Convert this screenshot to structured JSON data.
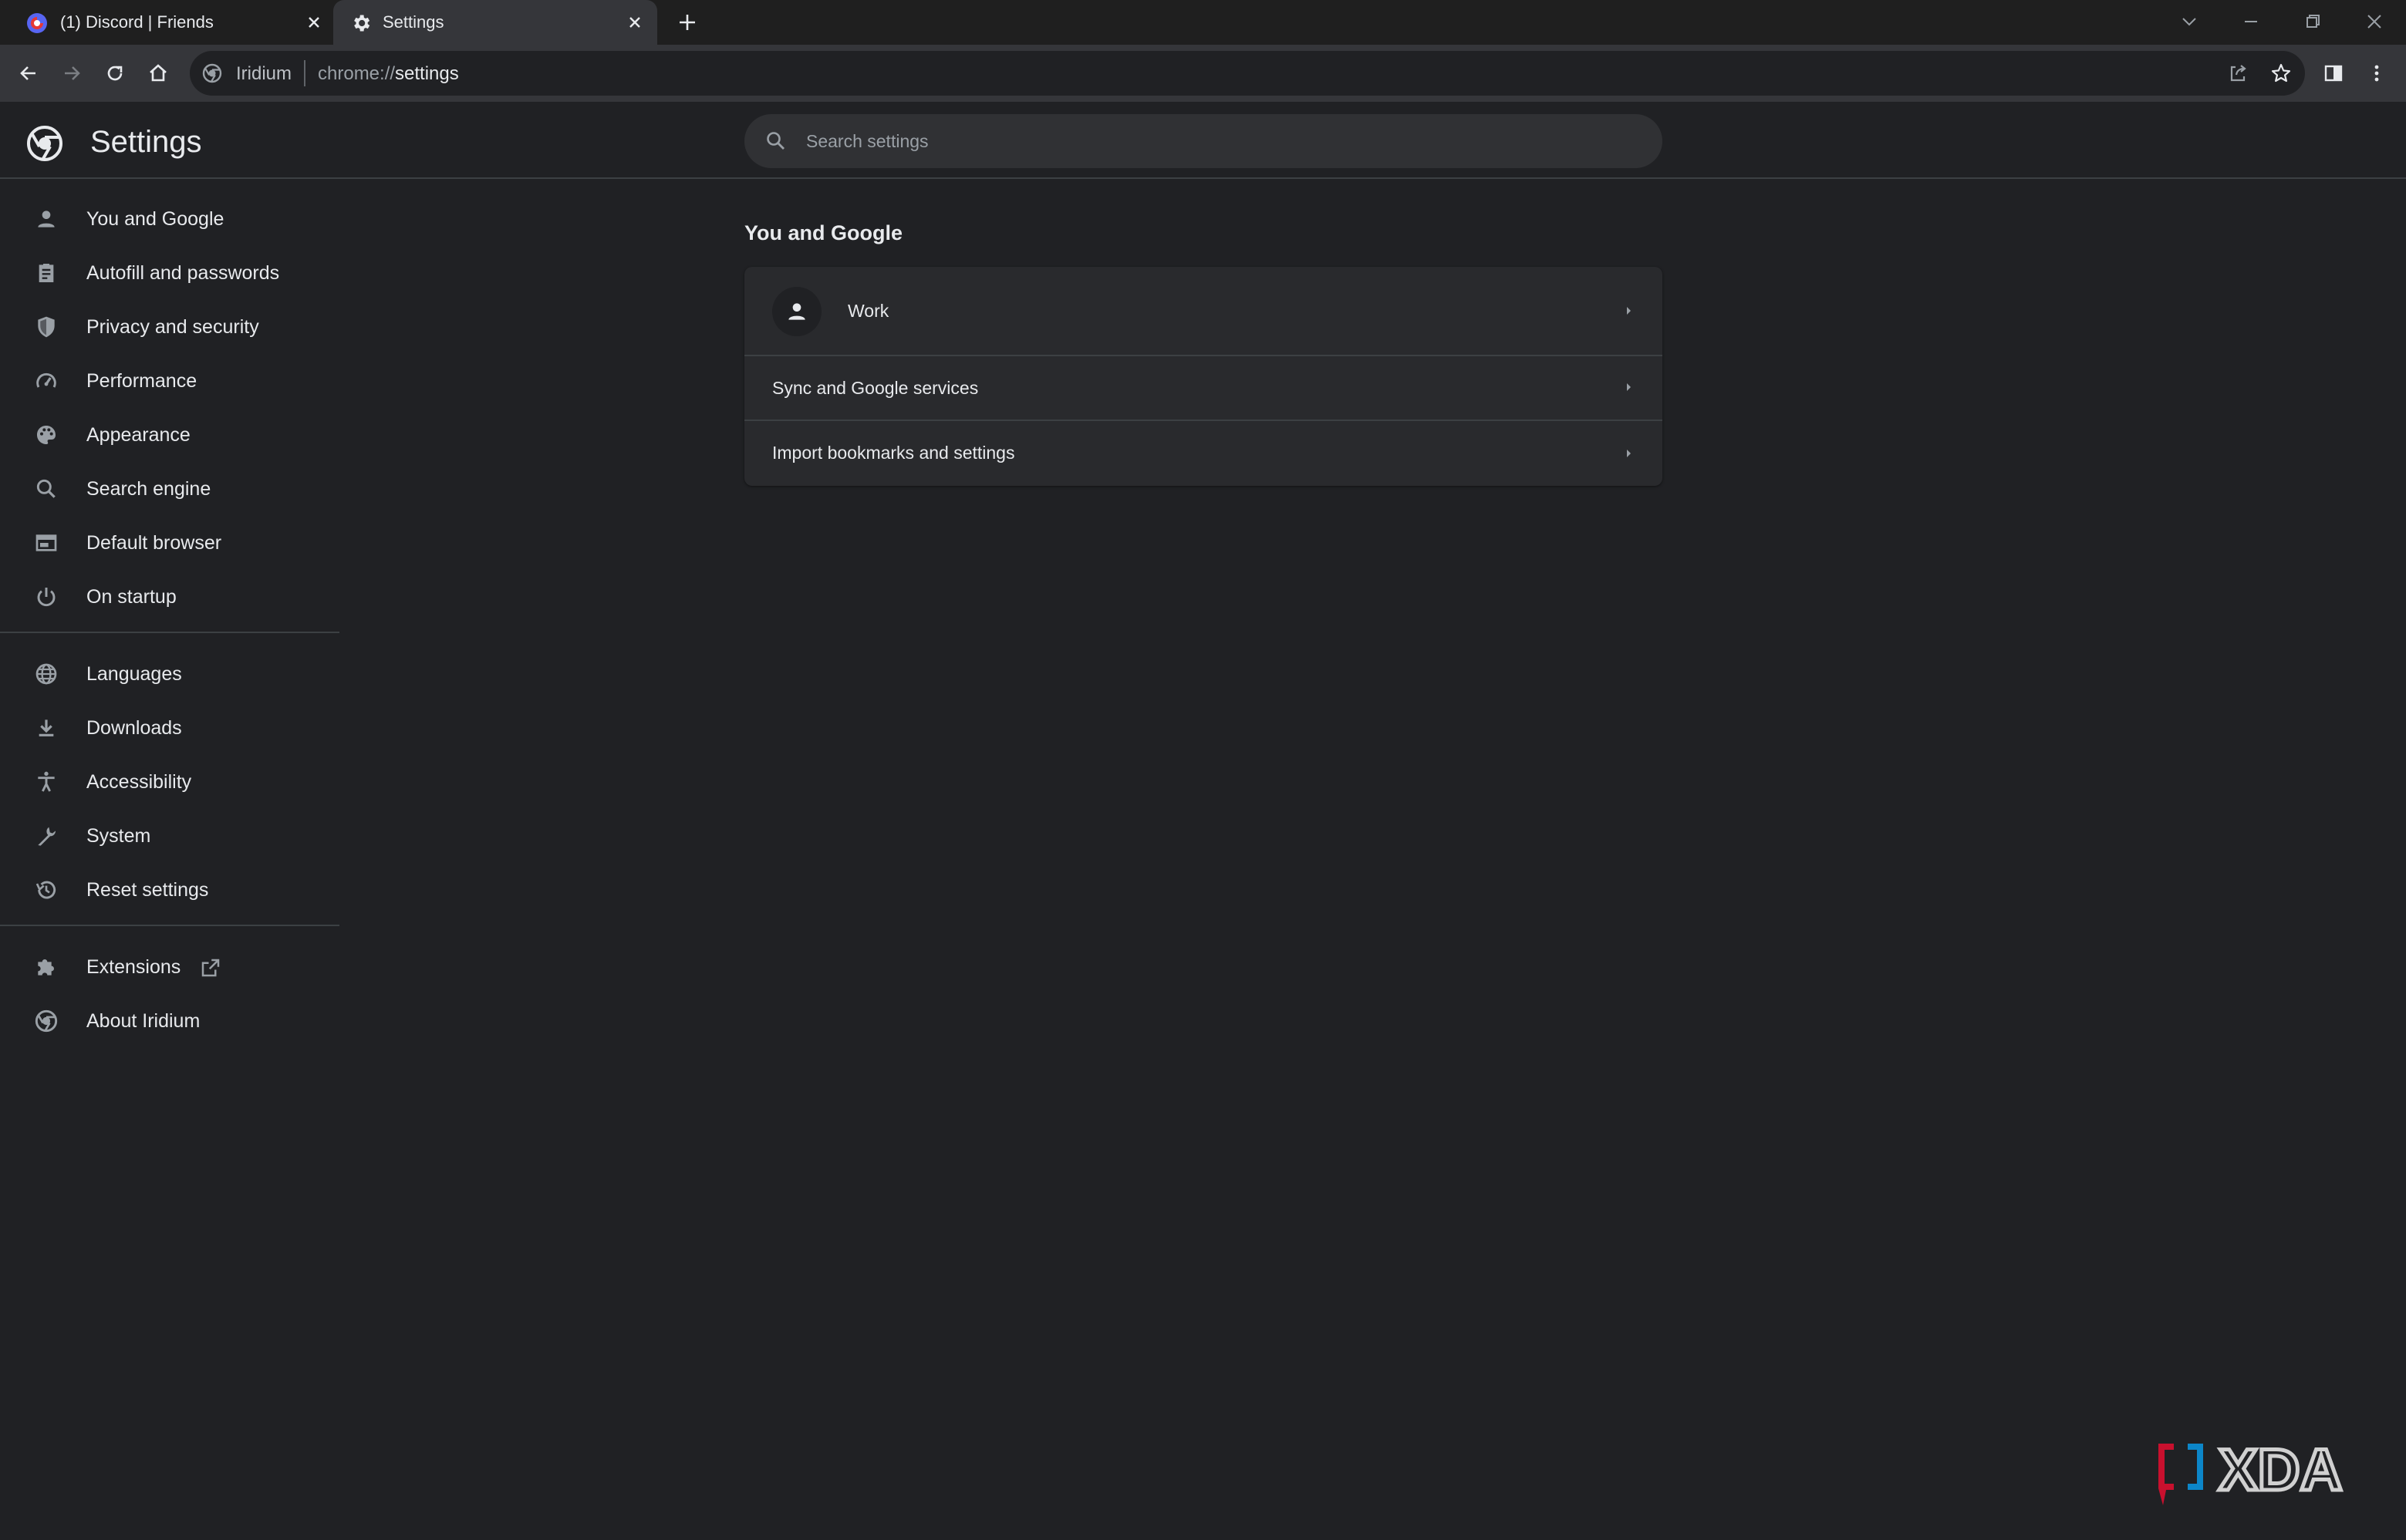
{
  "browser": {
    "tabs": [
      {
        "title": "(1) Discord | Friends",
        "favicon": "discord-icon",
        "active": false
      },
      {
        "title": "Settings",
        "favicon": "gear-icon",
        "active": true
      }
    ],
    "omnibox": {
      "site_name": "Iridium",
      "url_scheme": "chrome://",
      "url_path": "settings"
    }
  },
  "settings": {
    "title": "Settings",
    "search": {
      "placeholder": "Search settings"
    },
    "nav": {
      "group1": [
        {
          "label": "You and Google",
          "icon": "person-icon"
        },
        {
          "label": "Autofill and passwords",
          "icon": "clipboard-icon"
        },
        {
          "label": "Privacy and security",
          "icon": "shield-icon"
        },
        {
          "label": "Performance",
          "icon": "speedometer-icon"
        },
        {
          "label": "Appearance",
          "icon": "palette-icon"
        },
        {
          "label": "Search engine",
          "icon": "search-icon"
        },
        {
          "label": "Default browser",
          "icon": "browser-window-icon"
        },
        {
          "label": "On startup",
          "icon": "power-icon"
        }
      ],
      "group2": [
        {
          "label": "Languages",
          "icon": "globe-icon"
        },
        {
          "label": "Downloads",
          "icon": "download-icon"
        },
        {
          "label": "Accessibility",
          "icon": "accessibility-icon"
        },
        {
          "label": "System",
          "icon": "wrench-icon"
        },
        {
          "label": "Reset settings",
          "icon": "history-icon"
        }
      ],
      "group3": [
        {
          "label": "Extensions",
          "icon": "puzzle-icon"
        },
        {
          "label": "About Iridium",
          "icon": "chromium-logo-icon"
        }
      ]
    },
    "main": {
      "section_title": "You and Google",
      "rows": [
        {
          "label": "Work"
        },
        {
          "label": "Sync and Google services"
        },
        {
          "label": "Import bookmarks and settings"
        }
      ]
    }
  },
  "watermark": {
    "text": "XDA"
  },
  "colors": {
    "background": "#202124",
    "toolbar": "#35363a",
    "card": "#292a2d",
    "text": "#e8eaed",
    "icon": "#9aa0a6"
  }
}
